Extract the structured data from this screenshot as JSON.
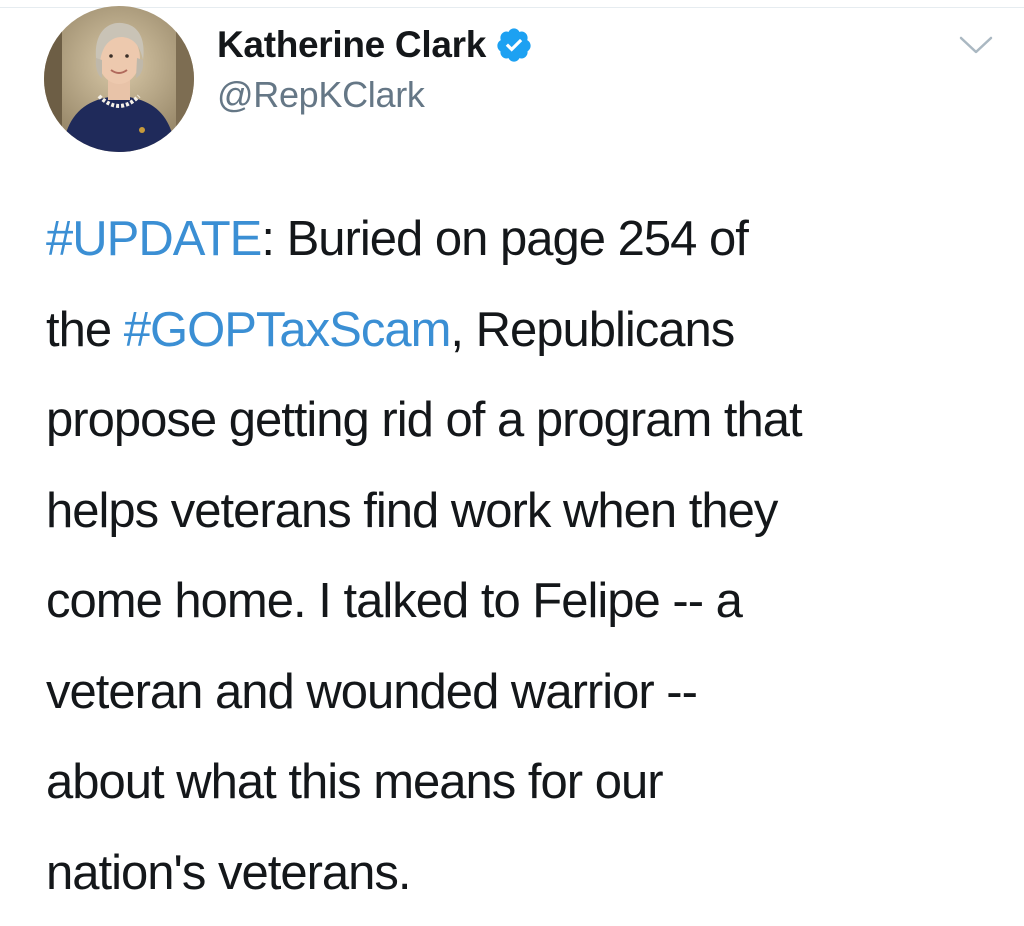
{
  "author": {
    "display_name": "Katherine Clark",
    "handle": "@RepKClark",
    "verified": true,
    "verified_color": "#1da1f2"
  },
  "tweet": {
    "lines": [
      [
        {
          "text": "#UPDATE",
          "type": "hashtag"
        },
        {
          "text": ": Buried on page 254 of",
          "type": "plain"
        }
      ],
      [
        {
          "text": "the ",
          "type": "plain"
        },
        {
          "text": "#GOPTaxScam",
          "type": "hashtag"
        },
        {
          "text": ", Republicans",
          "type": "plain"
        }
      ],
      [
        {
          "text": "propose getting rid of a program that",
          "type": "plain"
        }
      ],
      [
        {
          "text": "helps veterans find work when they",
          "type": "plain"
        }
      ],
      [
        {
          "text": "come home. I talked to Felipe -- a",
          "type": "plain"
        }
      ],
      [
        {
          "text": "veteran and wounded warrior --",
          "type": "plain"
        }
      ],
      [
        {
          "text": "about what this means for our",
          "type": "plain"
        }
      ],
      [
        {
          "text": "nation's veterans.",
          "type": "plain"
        }
      ]
    ]
  },
  "icons": {
    "verified": "verified-badge-icon",
    "menu": "chevron-down-icon"
  },
  "colors": {
    "hashtag": "#3b8fd4",
    "text": "#14171a",
    "handle": "#657786"
  }
}
